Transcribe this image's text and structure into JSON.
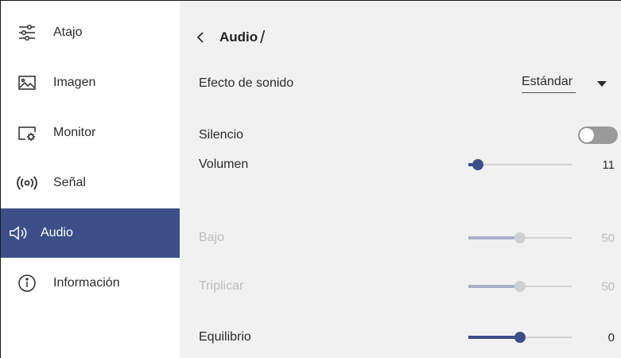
{
  "sidebar": {
    "items": [
      {
        "label": "Atajo",
        "icon": "sliders-icon",
        "active": false
      },
      {
        "label": "Imagen",
        "icon": "image-icon",
        "active": false
      },
      {
        "label": "Monitor",
        "icon": "monitor-settings-icon",
        "active": false
      },
      {
        "label": "Señal",
        "icon": "signal-icon",
        "active": false
      },
      {
        "label": "Audio",
        "icon": "speaker-icon",
        "active": true
      },
      {
        "label": "Información",
        "icon": "info-icon",
        "active": false
      }
    ]
  },
  "header": {
    "title": "Audio",
    "separator": "/"
  },
  "settings": {
    "sound_effect": {
      "label": "Efecto de sonido",
      "value": "Estándar"
    },
    "mute": {
      "label": "Silencio",
      "on": false
    },
    "volume": {
      "label": "Volumen",
      "value": "11",
      "level": 0.09,
      "disabled": false
    },
    "bass": {
      "label": "Bajo",
      "value": "50",
      "level": 0.5,
      "disabled": true
    },
    "treble": {
      "label": "Triplicar",
      "value": "50",
      "level": 0.5,
      "disabled": true
    },
    "balance": {
      "label": "Equilibrio",
      "value": "0",
      "level": 0.5,
      "disabled": false
    }
  },
  "colors": {
    "accent": "#3c4f88",
    "panel_bg": "#f1f1f1",
    "disabled_text": "#bdbdbd"
  }
}
